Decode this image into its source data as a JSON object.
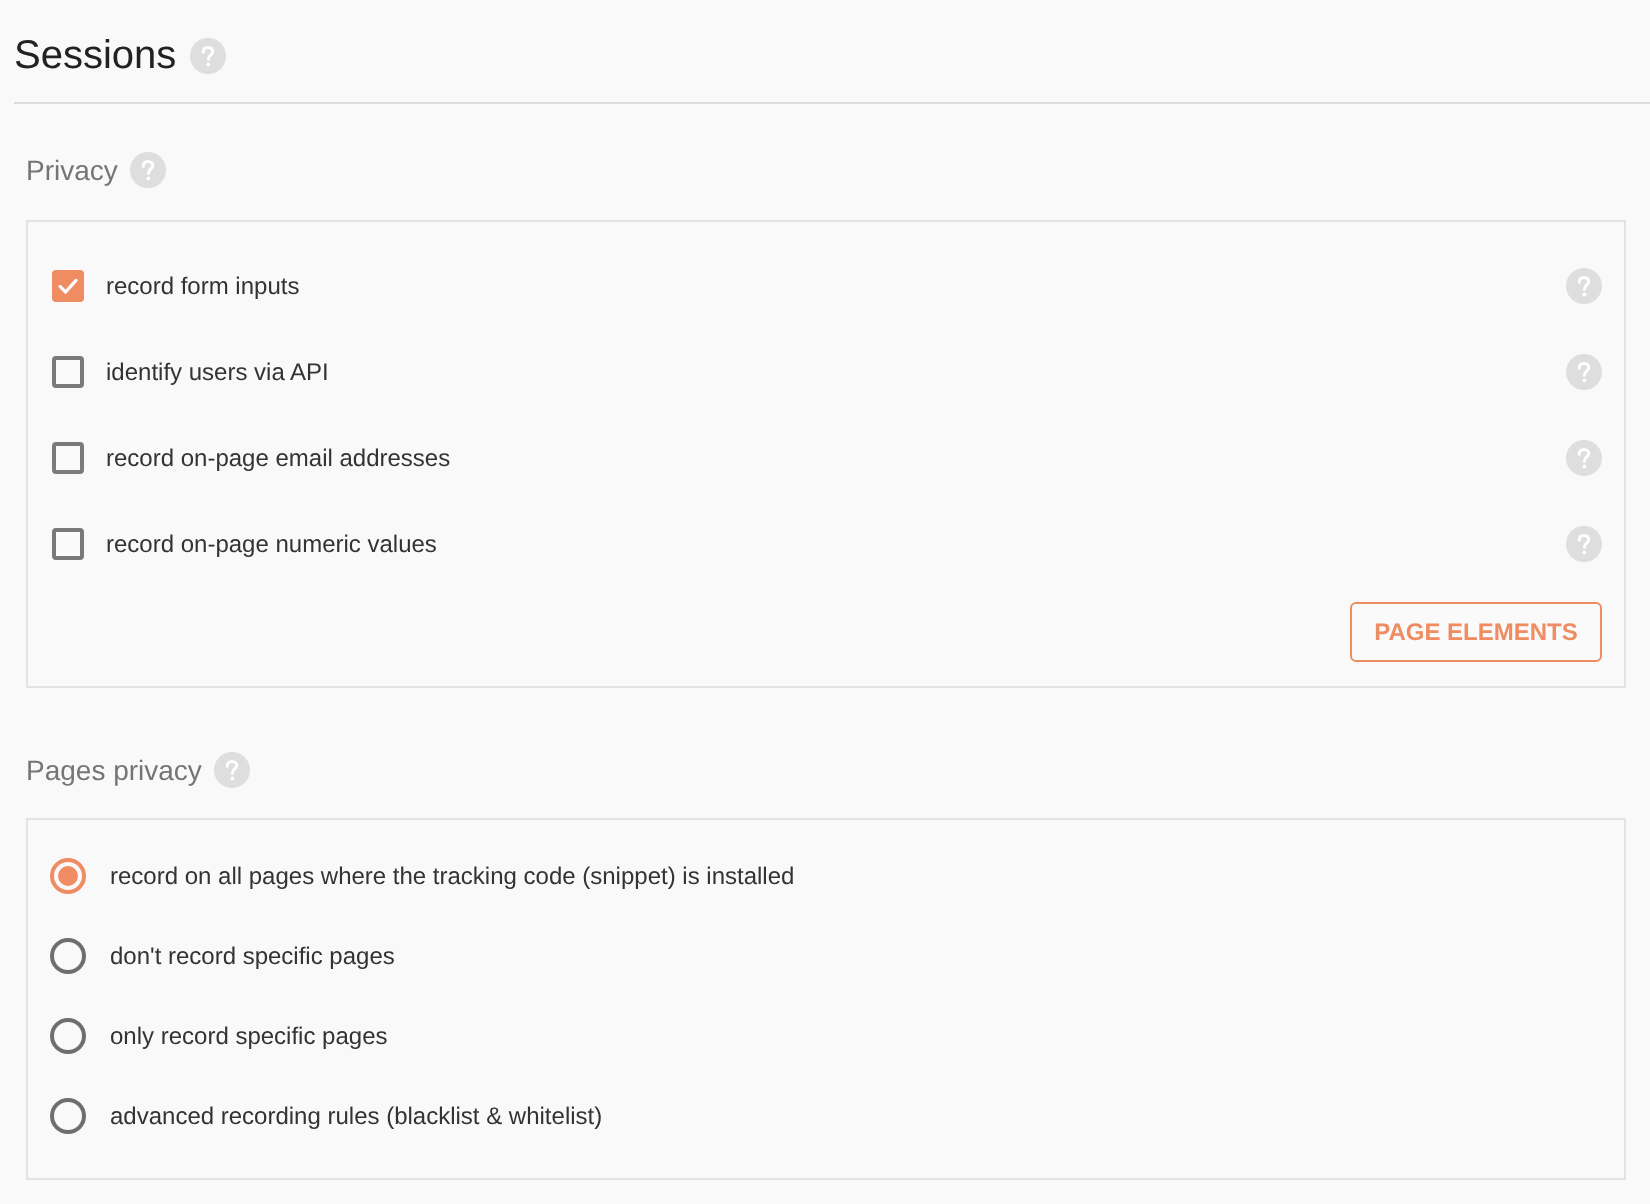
{
  "title": "Sessions",
  "privacy": {
    "heading": "Privacy",
    "options": [
      {
        "label": "record form inputs",
        "checked": true
      },
      {
        "label": "identify users via API",
        "checked": false
      },
      {
        "label": "record on-page email addresses",
        "checked": false
      },
      {
        "label": "record on-page numeric values",
        "checked": false
      }
    ],
    "button": "PAGE ELEMENTS"
  },
  "pages_privacy": {
    "heading": "Pages privacy",
    "options": [
      {
        "label": "record on all pages where the tracking code (snippet) is installed",
        "selected": true
      },
      {
        "label": "don't record specific pages",
        "selected": false
      },
      {
        "label": "only record specific pages",
        "selected": false
      },
      {
        "label": "advanced recording rules (blacklist & whitelist)",
        "selected": false
      }
    ]
  }
}
